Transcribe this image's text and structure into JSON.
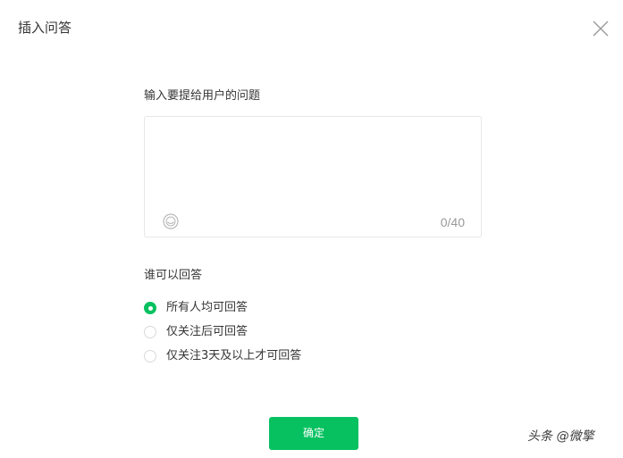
{
  "dialog": {
    "title": "插入问答",
    "close_icon": "close-icon"
  },
  "question": {
    "label": "输入要提给用户的问题",
    "value": "",
    "placeholder": "",
    "counter": "0/40",
    "emoji_icon": "emoji-icon"
  },
  "audience": {
    "label": "谁可以回答",
    "options": [
      {
        "label": "所有人均可回答",
        "checked": true
      },
      {
        "label": "仅关注后可回答",
        "checked": false
      },
      {
        "label": "仅关注3天及以上才可回答",
        "checked": false
      }
    ]
  },
  "actions": {
    "confirm_label": "确定"
  },
  "watermark": {
    "text": "头条 @微擎"
  },
  "colors": {
    "accent": "#07c160",
    "text": "#353535",
    "muted": "#9a9a9a",
    "border": "#e7e7e7"
  }
}
